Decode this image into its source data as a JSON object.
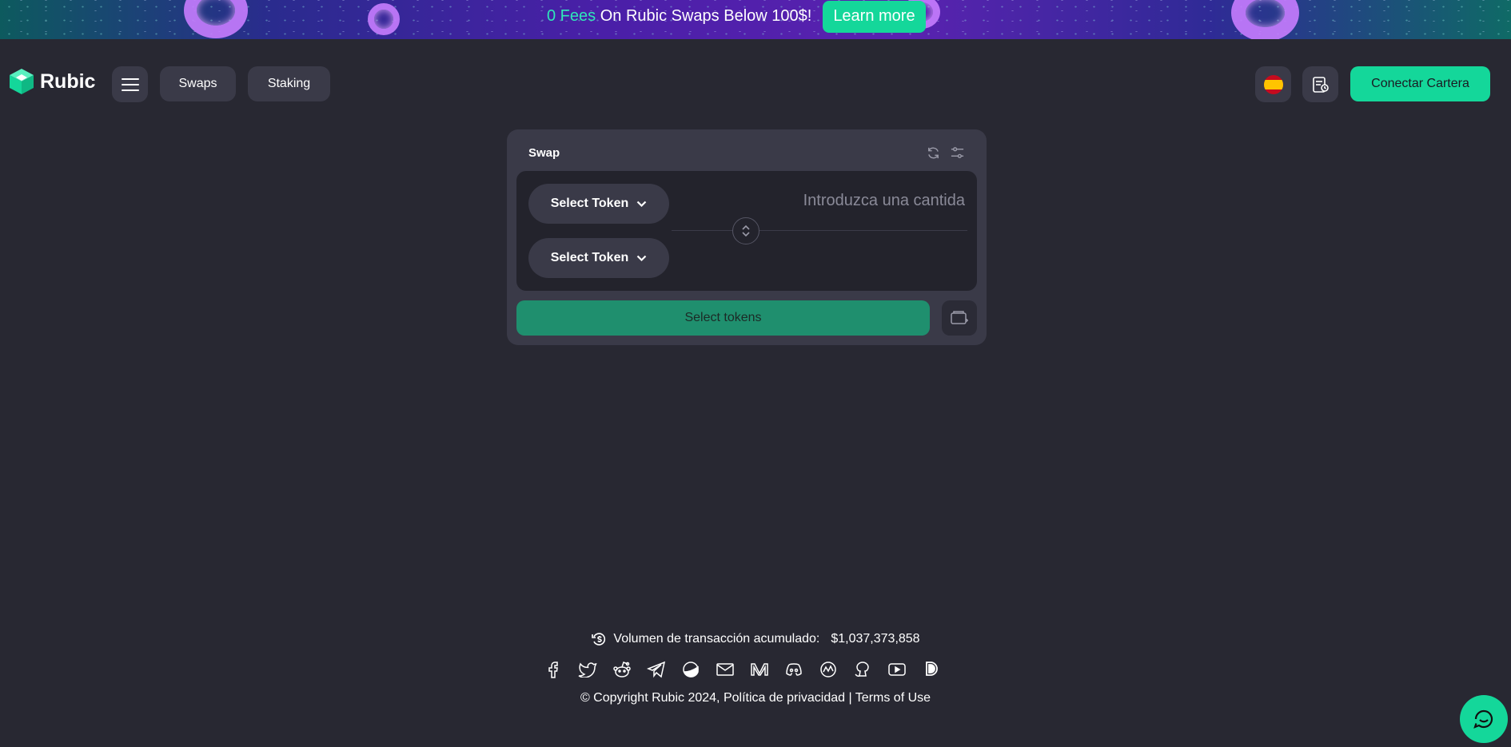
{
  "banner": {
    "fees_accent": "0 Fees",
    "text": " On Rubic Swaps Below 100$!",
    "button_label": "Learn more"
  },
  "header": {
    "logo_text": "Rubic",
    "nav": [
      "Swaps",
      "Staking"
    ],
    "language_flag": "spain-flag-icon",
    "connect_label": "Conectar Cartera"
  },
  "swap": {
    "title": "Swap",
    "from_token_label": "Select Token",
    "to_token_label": "Select Token",
    "amount_placeholder": "Introduzca una cantida",
    "action_label": "Select tokens"
  },
  "footer": {
    "volume_label": "Volumen de transacción acumulado:",
    "volume_value": "$1,037,373,858",
    "copyright_prefix": "© Copyright Rubic 2024,",
    "privacy_label": "Política de privacidad",
    "separator": "|",
    "terms_label": "Terms of Use",
    "socials": [
      "facebook-icon",
      "twitter-icon",
      "reddit-icon",
      "telegram-icon",
      "coingecko-icon",
      "mail-icon",
      "medium-icon",
      "discord-icon",
      "coinmarketcap-icon",
      "github-icon",
      "youtube-icon",
      "dex-icon"
    ]
  },
  "colors": {
    "background": "#282832",
    "accent": "#14d79a",
    "panel": "#3a3a48"
  }
}
